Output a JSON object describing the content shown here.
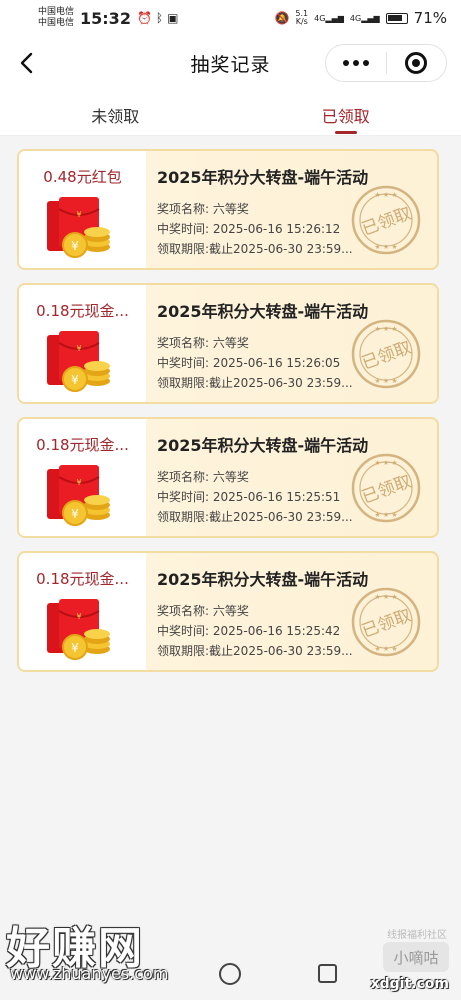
{
  "status_bar": {
    "carrier_1": "中国电信",
    "carrier_2": "中国电信",
    "time": "15:32",
    "net_speed_value": "5.1",
    "net_speed_unit": "K/s",
    "signal_1": "4G",
    "signal_2": "4G",
    "battery": "71%"
  },
  "nav": {
    "title": "抽奖记录"
  },
  "tabs": [
    {
      "label": "未领取",
      "active": false
    },
    {
      "label": "已领取",
      "active": true
    }
  ],
  "records": [
    {
      "prize": "0.48元红包",
      "title": "2025年积分大转盘-端午活动",
      "item": "奖项名称: 六等奖",
      "time": "中奖时间: 2025-06-16 15:26:12",
      "deadline": "领取期限:截止2025-06-30 23:59...",
      "stamp": "已领取"
    },
    {
      "prize": "0.18元现金...",
      "title": "2025年积分大转盘-端午活动",
      "item": "奖项名称: 六等奖",
      "time": "中奖时间: 2025-06-16 15:26:05",
      "deadline": "领取期限:截止2025-06-30 23:59...",
      "stamp": "已领取"
    },
    {
      "prize": "0.18元现金...",
      "title": "2025年积分大转盘-端午活动",
      "item": "奖项名称: 六等奖",
      "time": "中奖时间: 2025-06-16 15:25:51",
      "deadline": "领取期限:截止2025-06-30 23:59...",
      "stamp": "已领取"
    },
    {
      "prize": "0.18元现金...",
      "title": "2025年积分大转盘-端午活动",
      "item": "奖项名称: 六等奖",
      "time": "中奖时间: 2025-06-16 15:25:42",
      "deadline": "领取期限:截止2025-06-30 23:59...",
      "stamp": "已领取"
    }
  ],
  "watermarks": {
    "left_big": "好赚网",
    "left_url": "www.zhuanyes.com",
    "right_small": "线报福利社区",
    "right_box": "小嘀咕",
    "right_url": "xdgit.com"
  },
  "colors": {
    "accent": "#a3262b",
    "card_border": "#f2dca2",
    "card_bg": "#fdf1d6",
    "stamp": "#c9a46a"
  }
}
